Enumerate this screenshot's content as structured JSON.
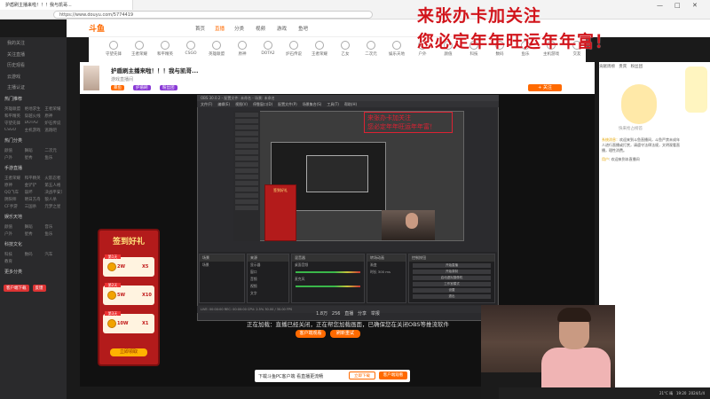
{
  "browser": {
    "tab_title": "护盾刷主播来啦！！！我与凯哥...",
    "address": "https://www.douyu.com/5774419",
    "controls": [
      "—",
      "□",
      "✕"
    ]
  },
  "overlay": {
    "line1": "来张办卡加关注",
    "line2": "您必定年年旺运年年富！"
  },
  "site": {
    "logo": "斗鱼",
    "nav": [
      "首页",
      "直播",
      "分类",
      "视频",
      "游戏",
      "鱼吧",
      "鱼吧"
    ],
    "nav_active_index": 1,
    "search_placeholder": "搜索主播名称或房间号",
    "categories": [
      "守望先锋",
      "王者荣耀",
      "和平精英",
      "CSGO",
      "英雄联盟",
      "原神",
      "DOTA2",
      "炉石传说",
      "王者荣耀",
      "乙女",
      "二次元",
      "娱乐天地",
      "户外",
      "颜值",
      "科技",
      "数码",
      "鱼乐",
      "主机游戏",
      "交友"
    ]
  },
  "stream": {
    "title": "护盾刷主播来啦！！！我与凯哥...",
    "category_label": "游戏直播间",
    "badges": [
      {
        "text": "暴鱼",
        "color": "#ff6a00"
      },
      {
        "text": "护盾刷",
        "color": "#8a3ad6"
      },
      {
        "text": "粉丝团",
        "color": "#8a3ad6"
      }
    ],
    "follow_label": "+ 关注"
  },
  "sidebar": {
    "rows": [
      "我的关注",
      "关注直播",
      "历史观看",
      "云游戏",
      "主播认证"
    ],
    "sections": [
      {
        "header": "热门推荐",
        "items": [
          "英雄联盟",
          "绝地求生",
          "王者荣耀",
          "和平精英",
          "穿越火线",
          "原神",
          "守望先锋",
          "DOTA2",
          "炉石传说",
          "CSGO",
          "主机游戏",
          "逃跑吧"
        ]
      },
      {
        "header": "热门分类",
        "items": [
          "颜值",
          "舞蹈",
          "二次元",
          "户外",
          "星秀",
          "鱼乐"
        ]
      },
      {
        "header": "手游直播",
        "items": [
          "王者荣耀",
          "和平精英",
          "火影忍者",
          "原神",
          "金铲铲",
          "第五人格",
          "QQ飞车",
          "崩坏",
          "决战平安京",
          "阴阳师",
          "明日方舟",
          "狼人杀",
          "CF手游",
          "三国杀",
          "元梦之星"
        ]
      },
      {
        "header": "娱乐天地",
        "items": [
          "颜值",
          "舞蹈",
          "音乐",
          "户外",
          "星秀",
          "鱼乐"
        ]
      },
      {
        "header": "科技文化",
        "items": [
          "科技",
          "数码",
          "汽车",
          "教育"
        ]
      },
      {
        "header": "更多分类",
        "items": []
      }
    ],
    "bottom_buttons": [
      "客户端下载",
      "反馈"
    ]
  },
  "obs": {
    "title": "OBS 30.0.2 - 配置文件: 未命名 - 场景: 未命名",
    "menu": [
      "文件(F)",
      "编辑(E)",
      "视图(V)",
      "停靠窗口(D)",
      "配置文件(P)",
      "场景集合(S)",
      "工具(T)",
      "帮助(H)"
    ],
    "panels": [
      {
        "title": "场景",
        "items": [
          "场景"
        ]
      },
      {
        "title": "来源",
        "items": [
          "显示器",
          "窗口",
          "音频",
          "视频",
          "文字"
        ]
      },
      {
        "title": "混音器",
        "items": [
          "桌面音频",
          "麦克风"
        ]
      },
      {
        "title": "转场动画",
        "items": [
          "渐变",
          "时长 300 ms"
        ]
      },
      {
        "title": "控制按钮",
        "items": [
          "开始直播",
          "开始录制",
          "启动虚拟摄像机",
          "工作室模式",
          "设置",
          "退出"
        ]
      }
    ],
    "status": "LIVE: 00:00:00  REC: 00:00:00  CPU: 2.5%  30.00 / 30.00 FPS",
    "mirror_line1": "来张办卡加关注",
    "mirror_line2": "您必定年年旺运年年富！"
  },
  "below_video": {
    "stats": [
      "1.8万",
      "256",
      "直播",
      "分享",
      "举报"
    ],
    "notice": "正在加载：直播已经关闭，正在帮您加载画面，已确保您在关闭OBS等推流软件",
    "buttons": [
      {
        "text": "客户端观看",
        "color": "#ff6a00"
      },
      {
        "text": "刷新重试",
        "color": "#ff6a00"
      }
    ]
  },
  "download_bar": {
    "text": "下载斗鱼PC客户端 看直播更流畅",
    "buttons": [
      "立即下载",
      "客户端观看"
    ]
  },
  "promo": {
    "title": "签到好礼",
    "cards": [
      {
        "day": "第1天",
        "amount": "2W",
        "multiplier": "X5"
      },
      {
        "day": "第2天",
        "amount": "5W",
        "multiplier": "X10"
      },
      {
        "day": "第3天",
        "amount": "10W",
        "multiplier": "X1"
      }
    ],
    "button": "立即领取"
  },
  "right_panel": {
    "tabs": [
      "贡献周榜",
      "贵宾",
      "粉丝团"
    ],
    "empty_text": "快来抢占榜首",
    "chat": [
      {
        "user": "系统消息：",
        "text": "欢迎来到斗鱼直播间，斗鱼严禁未成年人进行直播或打赏，请遵守法律法规，文明观看直播，理性消费。"
      },
      {
        "user": "用户",
        "text": "欢迎来到本直播间"
      }
    ]
  },
  "taskbar": {
    "time": "19:20",
    "date": "2024/1/4",
    "temp": "21°C 晴"
  },
  "colors": {
    "accent": "#ff6a00",
    "overlay_red": "#d1141b",
    "promo_red": "#b31b1b"
  }
}
